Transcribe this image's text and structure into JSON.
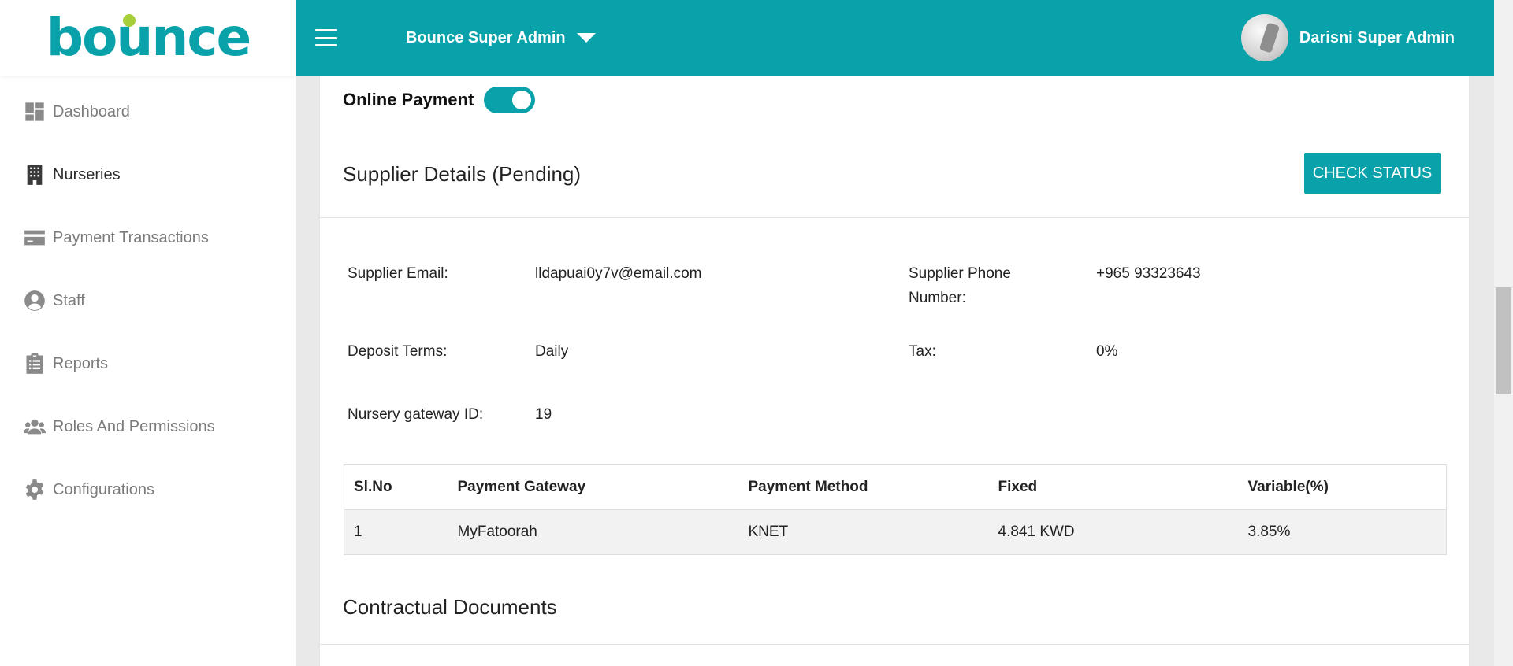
{
  "brand": {
    "logo_text": "bounce",
    "accent_color": "#0aa2aa",
    "dot_color": "#a6ce39"
  },
  "sidebar": {
    "items": [
      {
        "label": "Dashboard",
        "icon": "dashboard-icon",
        "active": false
      },
      {
        "label": "Nurseries",
        "icon": "building-icon",
        "active": true
      },
      {
        "label": "Payment Transactions",
        "icon": "credit-card-icon",
        "active": false
      },
      {
        "label": "Staff",
        "icon": "user-circle-icon",
        "active": false
      },
      {
        "label": "Reports",
        "icon": "clipboard-list-icon",
        "active": false
      },
      {
        "label": "Roles And Permissions",
        "icon": "users-group-icon",
        "active": false
      },
      {
        "label": "Configurations",
        "icon": "gear-icon",
        "active": false
      }
    ]
  },
  "header": {
    "role_selector": "Bounce Super Admin",
    "user_name": "Darisni Super Admin"
  },
  "online_payment": {
    "label": "Online Payment",
    "enabled": true
  },
  "supplier": {
    "title": "Supplier Details (Pending)",
    "check_status_label": "CHECK STATUS",
    "email_label": "Supplier Email:",
    "email_value": "lldapuai0y7v@email.com",
    "phone_label_line1": "Supplier Phone",
    "phone_label_line2": "Number:",
    "phone_value": "+965 93323643",
    "deposit_label": "Deposit Terms:",
    "deposit_value": "Daily",
    "tax_label": "Tax:",
    "tax_value": "0%",
    "gateway_id_label": "Nursery gateway ID:",
    "gateway_id_value": "19"
  },
  "gateway_table": {
    "headers": [
      "Sl.No",
      "Payment Gateway",
      "Payment Method",
      "Fixed",
      "Variable(%)"
    ],
    "rows": [
      [
        "1",
        "MyFatoorah",
        "KNET",
        "4.841 KWD",
        "3.85%"
      ]
    ]
  },
  "documents": {
    "title": "Contractual Documents"
  }
}
